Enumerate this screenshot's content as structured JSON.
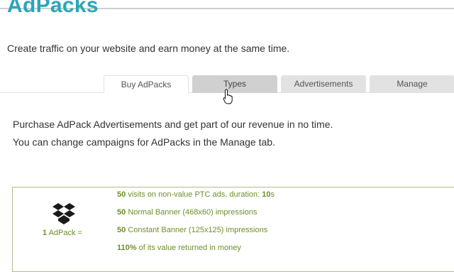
{
  "header": {
    "title": "AdPacks"
  },
  "subtitle": "Create traffic on your website and earn money at the same time.",
  "tabs": [
    {
      "label": "Buy AdPacks",
      "state": "active"
    },
    {
      "label": "Types",
      "state": "hover"
    },
    {
      "label": "Advertisements",
      "state": "inactive"
    },
    {
      "label": "Manage",
      "state": "inactive"
    }
  ],
  "intro": {
    "line1": "Purchase AdPack Advertisements and get part of our revenue in no time.",
    "line2": "You can change campaigns for AdPacks in the Manage tab."
  },
  "adpack": {
    "icon": "dropbox-icon",
    "label_count": "1",
    "label_text": "AdPack =",
    "features": [
      {
        "strong": "50",
        "text": "visits on non-value PTC ads, duration:",
        "strong2": "10",
        "suffix": "s"
      },
      {
        "strong": "50",
        "text": "Normal Banner (468x60) impressions"
      },
      {
        "strong": "50",
        "text": "Constant Banner (125x125) impressions"
      },
      {
        "strong": "110%",
        "text": "of its value returned in money"
      }
    ]
  },
  "colors": {
    "title": "#2aa6b8",
    "feature_text": "#6f8f2a",
    "box_border": "#b7b98a",
    "tab_inactive": "#e2e2e2",
    "tab_hover": "#d0d0d0"
  }
}
